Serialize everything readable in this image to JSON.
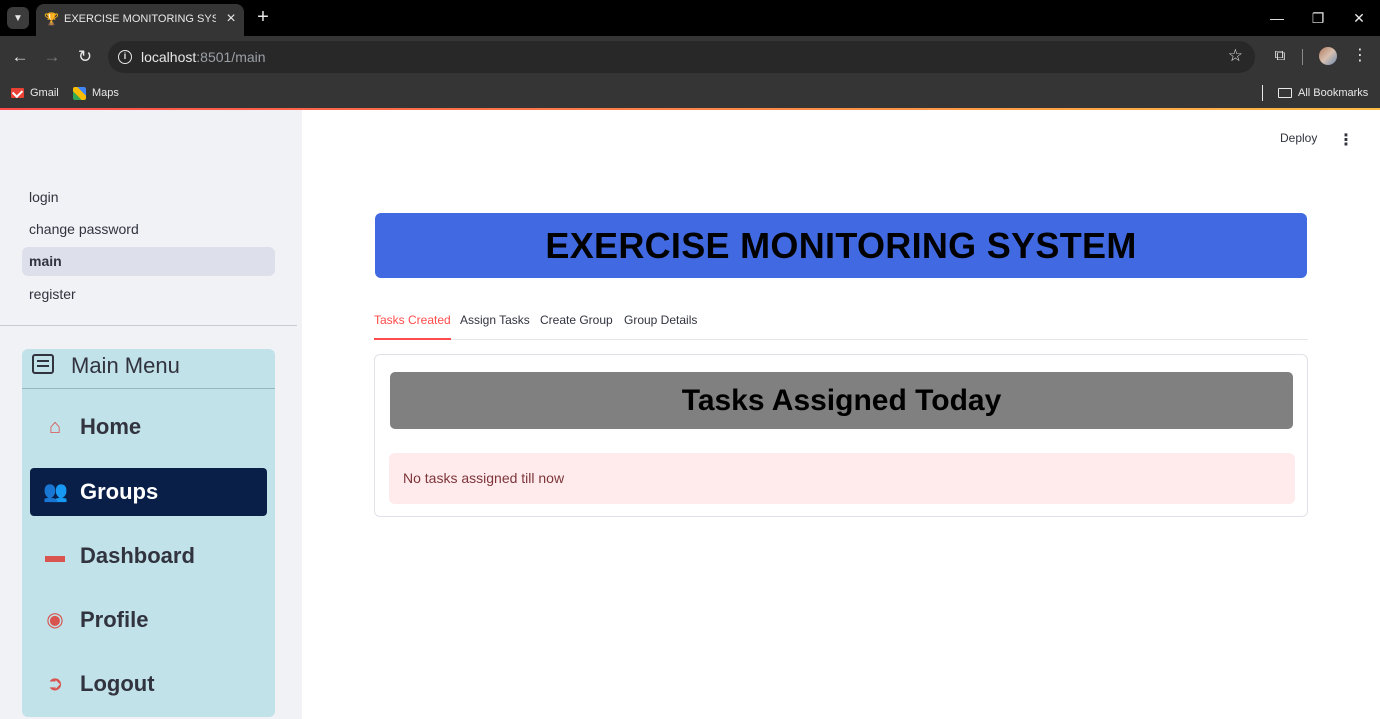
{
  "browser": {
    "tab_title": "EXERCISE MONITORING SYSTEM",
    "url_host": "localhost",
    "url_path": ":8501/main",
    "bookmarks": [
      "Gmail",
      "Maps"
    ],
    "all_bookmarks": "All Bookmarks"
  },
  "sidebar": {
    "pages": [
      "login",
      "change password",
      "main",
      "register"
    ],
    "active_page": "main",
    "menu": {
      "title": "Main Menu",
      "items": [
        {
          "label": "Home",
          "icon": "house-icon"
        },
        {
          "label": "Groups",
          "icon": "people-icon"
        },
        {
          "label": "Dashboard",
          "icon": "display-icon"
        },
        {
          "label": "Profile",
          "icon": "person-circle-icon"
        },
        {
          "label": "Logout",
          "icon": "box-arrow-right-icon"
        }
      ],
      "selected": "Groups",
      "icon_color": "#d9544f",
      "selected_bg": "#0a1f48",
      "bg": "#c2e2ea"
    }
  },
  "header": {
    "deploy_label": "Deploy"
  },
  "main": {
    "title": "EXERCISE MONITORING SYSTEM",
    "title_bg": "#4169e1",
    "tabs": [
      "Tasks Created",
      "Assign Tasks",
      "Create Group",
      "Group Details"
    ],
    "active_tab": "Tasks Created",
    "panel_title": "Tasks Assigned Today",
    "panel_title_bg": "#808080",
    "alert_text": "No tasks assigned till now",
    "accent_color": "#ff4b4b"
  }
}
